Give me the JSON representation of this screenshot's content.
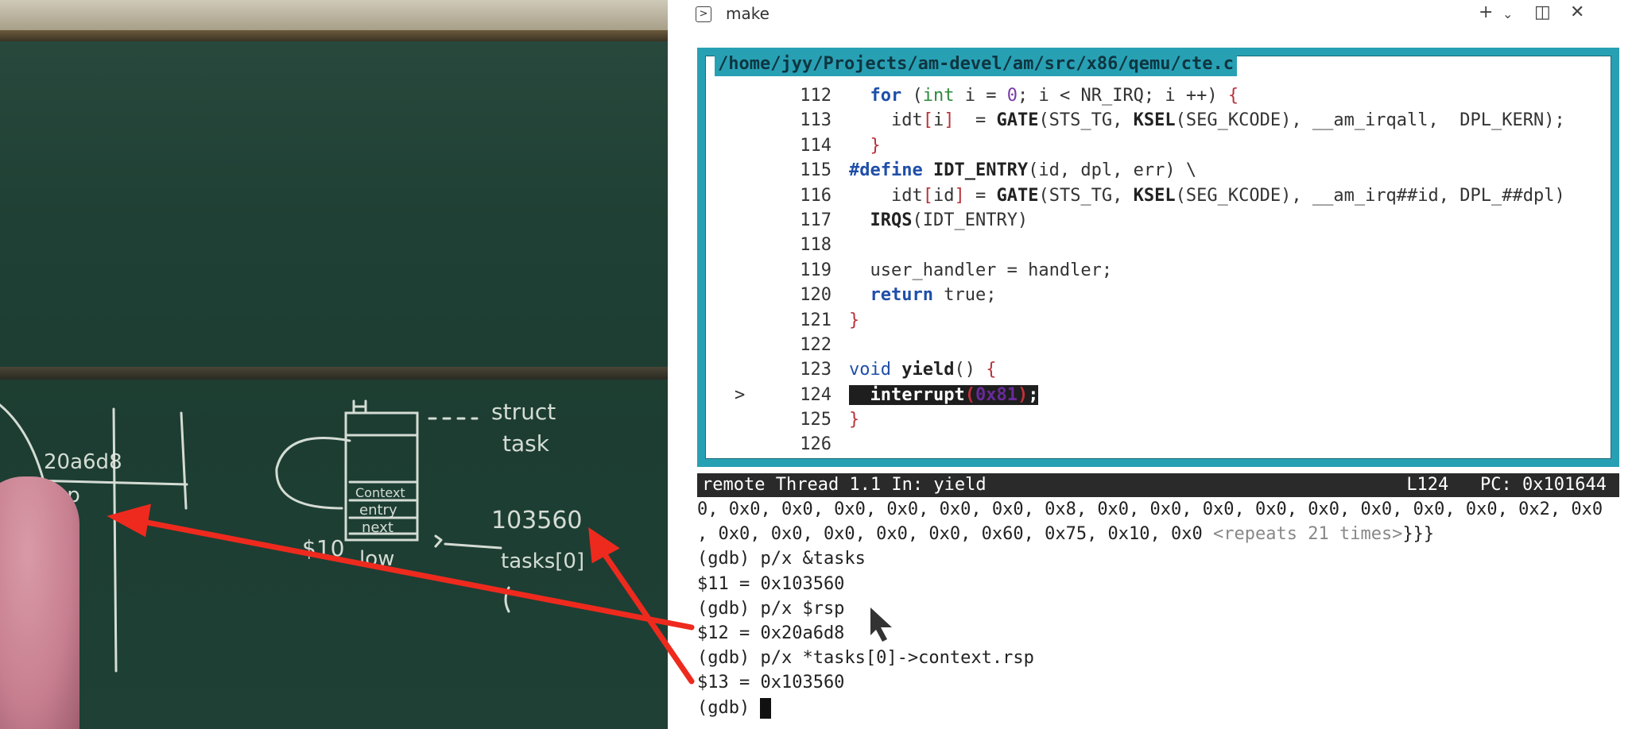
{
  "terminal": {
    "tab_title": "make",
    "tab_icon": "terminal-icon",
    "actions": {
      "add": "+",
      "dropdown": "⌄",
      "split": "◫",
      "close": "✕"
    },
    "source_path": "/home/jyy/Projects/am-devel/am/src/x86/qemu/cte.c",
    "source_lines": [
      {
        "num": "112",
        "code": "  for (int i = 0; i < NR_IRQ; i ++) {"
      },
      {
        "num": "113",
        "code": "    idt[i]  = GATE(STS_TG, KSEL(SEG_KCODE), __am_irqall,  DPL_KERN);"
      },
      {
        "num": "114",
        "code": "  }"
      },
      {
        "num": "115",
        "code": "#define IDT_ENTRY(id, dpl, err) \\"
      },
      {
        "num": "116",
        "code": "    idt[id] = GATE(STS_TG, KSEL(SEG_KCODE), __am_irq##id, DPL_##dpl)"
      },
      {
        "num": "117",
        "code": "  IRQS(IDT_ENTRY)"
      },
      {
        "num": "118",
        "code": ""
      },
      {
        "num": "119",
        "code": "  user_handler = handler;"
      },
      {
        "num": "120",
        "code": "  return true;"
      },
      {
        "num": "121",
        "code": "}"
      },
      {
        "num": "122",
        "code": ""
      },
      {
        "num": "123",
        "code": "void yield() {"
      },
      {
        "num": "124",
        "code": "  interrupt(0x81);",
        "current": true
      },
      {
        "num": "125",
        "code": "}"
      },
      {
        "num": "126",
        "code": ""
      }
    ],
    "current_marker": ">",
    "status": {
      "left": "remote Thread 1.1 In: yield",
      "line": "L124",
      "pc": "PC: 0x101644"
    },
    "gdb_lines": [
      "0, 0x0, 0x0, 0x0, 0x0, 0x0, 0x0, 0x8, 0x0, 0x0, 0x0, 0x0, 0x0, 0x0, 0x0, 0x0, 0x2, 0x0",
      ", 0x0, 0x0, 0x0, 0x0, 0x0, 0x60, 0x75, 0x10, 0x0 ",
      "(gdb) p/x &tasks",
      "$11 = 0x103560",
      "(gdb) p/x $rsp",
      "$12 = 0x20a6d8",
      "(gdb) p/x *tasks[0]->context.rsp",
      "$13 = 0x103560",
      "(gdb) "
    ],
    "gdb_repeat_note": "<repeats 21 times>",
    "gdb_repeat_tail": "}}}"
  },
  "board": {
    "chalk_texts": [
      "20a6d8",
      "rsp",
      "H",
      "struct",
      "task",
      "Context",
      "entry",
      "next",
      "103560",
      "tasks[0]",
      "$10",
      "low"
    ]
  }
}
